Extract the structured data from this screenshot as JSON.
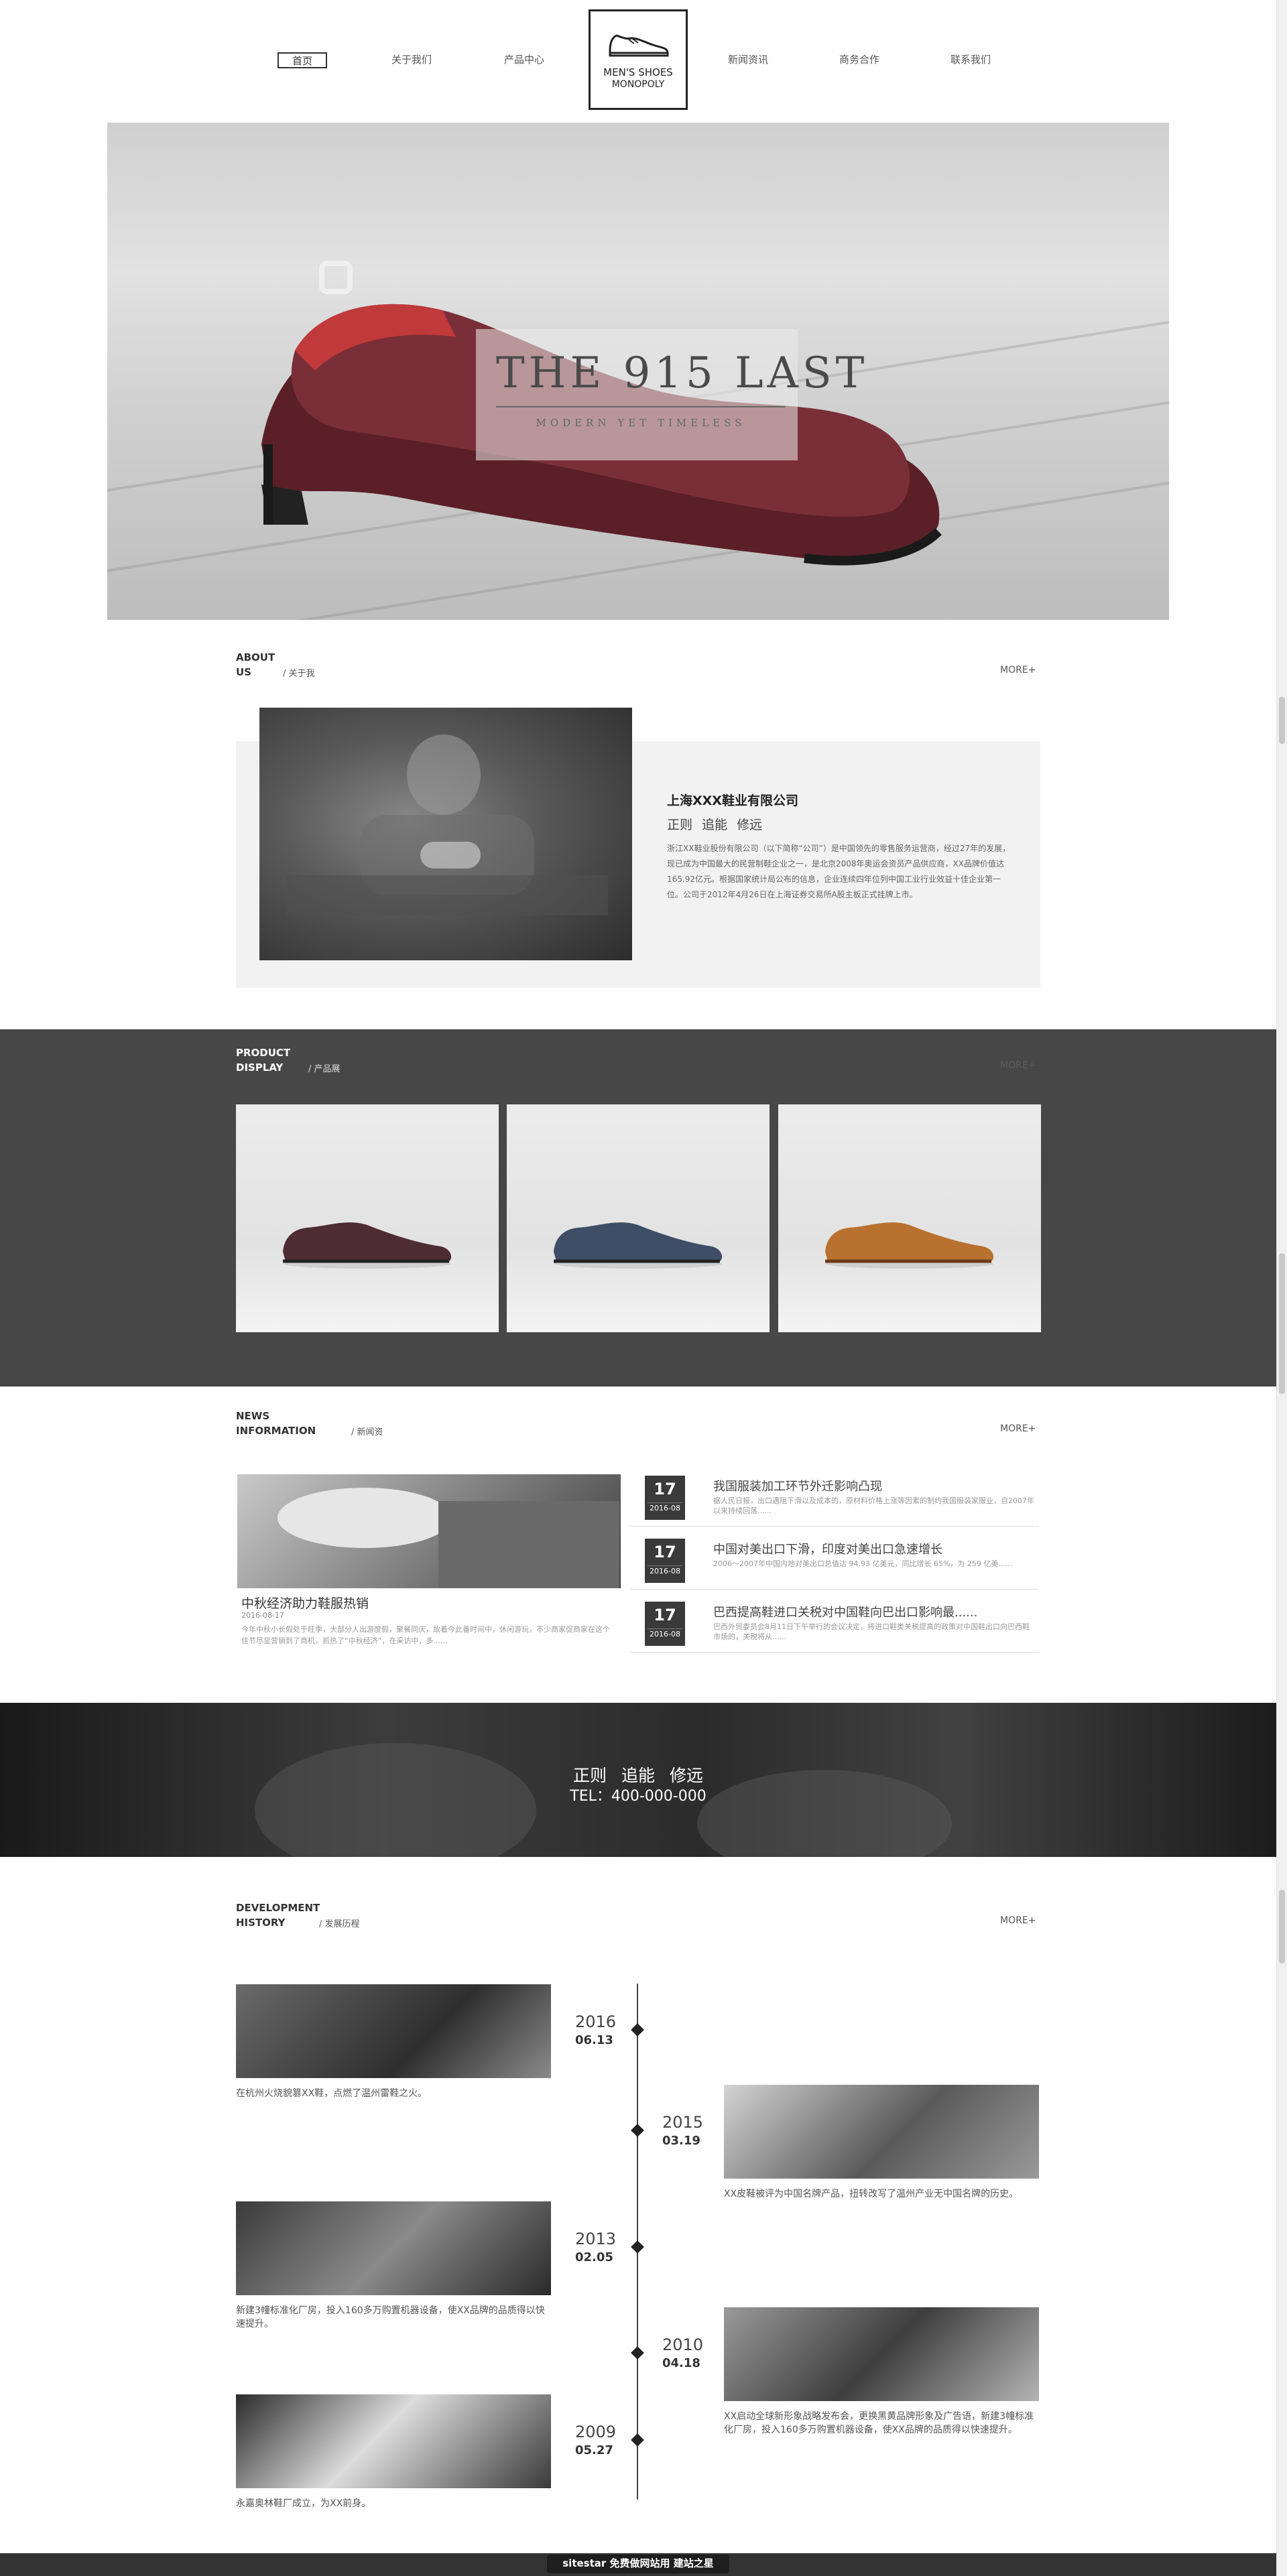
{
  "nav": {
    "items": [
      "首页",
      "关于我们",
      "产品中心",
      "新闻资讯",
      "商务合作",
      "联系我们"
    ],
    "logo_line1": "MEN'S SHOES",
    "logo_line2": "MONOPOLY"
  },
  "hero": {
    "title": "THE 915 LAST",
    "subtitle": "MODERN YET TIMELESS"
  },
  "about": {
    "title_en_1": "ABOUT",
    "title_en_2": "US",
    "title_cn": "/ 关于我",
    "more": "MORE+",
    "company": "上海XXX鞋业有限公司",
    "motto": "正则 追能 修远",
    "body": "浙江XX鞋业股份有限公司（以下简称“公司”）是中国领先的零售服务运营商，经过27年的发展，现已成为中国最大的民营制鞋企业之一，是北京2008年奥运会资员产品供应商，XX品牌价值达165.92亿元。根据国家统计局公布的信息，企业连续四年位列中国工业行业效益十佳企业第一位。公司于2012年4月26日在上海证券交易所A股主板正式挂牌上市。"
  },
  "products": {
    "title_en_1": "PRODUCT",
    "title_en_2": "DISPLAY",
    "title_cn": "/ 产品展",
    "more": "MORE+",
    "colors": [
      "#4e2c34",
      "#3d4e66",
      "#b9712f"
    ]
  },
  "news": {
    "title_en_1": "NEWS",
    "title_en_2": "INFORMATION",
    "title_cn": "/ 新闻资",
    "more": "MORE+",
    "featured": {
      "title": "中秋经济助力鞋服热销",
      "date": "2016-08-17",
      "summary": "今年中秋小长假处于旺季，大部分人出游度假，聚餐同庆，故着今此番时间中，休闲游玩，不少商家促商家在这个佳节尽显营销到了商机，抓热了“中秋经济”，在采访中，多......"
    },
    "items": [
      {
        "day": "17",
        "month": "2016-08",
        "title": "我国服装加工环节外迁影响凸现",
        "summary": "据人民日报，出口遇阻下滑以及成本的，原材料价格上涨等因素的制约我国服装家服业，自2007年以来持续回落......"
      },
      {
        "day": "17",
        "month": "2016-08",
        "title": "中国对美出口下滑，印度对美出口急速增长",
        "summary": "2006～2007年中国内地对美出口总值达 94.93 亿美元，同比增长 65%，为 259 亿美......"
      },
      {
        "day": "17",
        "month": "2016-08",
        "title": "巴西提高鞋进口关税对中国鞋向巴出口影响最......",
        "summary": "巴西外贸委员会8月11日下午举行的会议决定，将进口鞋类关税提高的政策对中国鞋出口向巴西鞋市场的，关税将从......"
      }
    ]
  },
  "banner": {
    "motto": "正则 追能 修远",
    "tel": "TEL：400-000-000"
  },
  "history": {
    "title_en_1": "DEVELOPMENT",
    "title_en_2": "HISTORY",
    "title_cn": "/ 发展历程",
    "more": "MORE+",
    "events": [
      {
        "year": "2016",
        "md": "06.13",
        "caption": "在杭州火烧貌篡XX鞋，点燃了温州雷鞋之火。"
      },
      {
        "year": "2015",
        "md": "03.19",
        "caption": "XX皮鞋被评为中国名牌产品，扭转改写了温州产业无中国名牌的历史。"
      },
      {
        "year": "2013",
        "md": "02.05",
        "caption": "新建3幢标准化厂房，投入160多万购置机器设备，使XX品牌的品质得以快速提升。"
      },
      {
        "year": "2010",
        "md": "04.18",
        "caption": "XX启动全球新形象战略发布会，更换黑黄品牌形象及广告语，新建3幢标准化厂房，投入160多万购置机器设备，使XX品牌的品质得以快速提升。"
      },
      {
        "year": "2009",
        "md": "05.27",
        "caption": "永嘉奥林鞋厂成立，为XX前身。"
      }
    ]
  },
  "footer": {
    "badge": "sitestar 免费做网站用 建站之星"
  }
}
